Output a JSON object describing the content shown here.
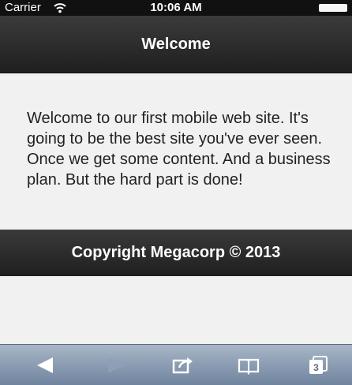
{
  "status_bar": {
    "carrier": "Carrier",
    "time": "10:06 AM"
  },
  "header": {
    "title": "Welcome"
  },
  "content": {
    "text": "Welcome to our first mobile web site. It's going to be the best site you've ever seen. Once we get some content. And a business plan. But the hard part is done!"
  },
  "footer": {
    "text": "Copyright Megacorp © 2013"
  },
  "toolbar": {
    "tabs_count": "3",
    "icons": [
      "back-icon",
      "forward-icon",
      "share-icon",
      "bookmarks-icon",
      "tabs-icon"
    ]
  }
}
